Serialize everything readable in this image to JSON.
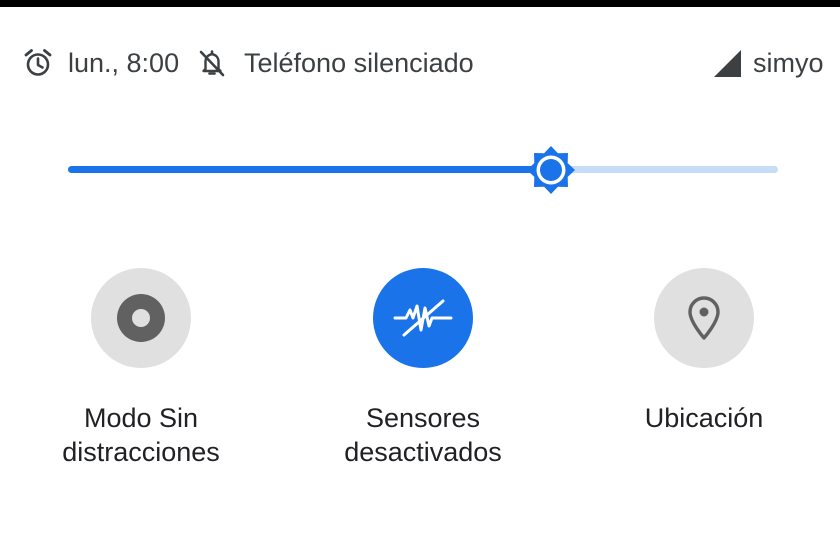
{
  "status_bar": {
    "alarm_icon": "alarm-clock-icon",
    "alarm_time": "lun., 8:00",
    "mute_icon": "bell-off-icon",
    "ringer_status": "Teléfono silenciado",
    "signal_icon": "signal-icon",
    "carrier": "simyo"
  },
  "brightness": {
    "icon": "brightness-icon",
    "level": 0.68,
    "accent_color": "#1a73e8",
    "track_color": "#c6dcf7"
  },
  "tiles": [
    {
      "label_line1": "Modo Sin",
      "label_line2": "distracciones",
      "icon": "focus-mode-icon",
      "active": false,
      "color": "#e0e0e0"
    },
    {
      "label_line1": "Sensores",
      "label_line2": "desactivados",
      "icon": "sensors-off-icon",
      "active": true,
      "color": "#1a73e8"
    },
    {
      "label_line1": "Ubicación",
      "label_line2": "",
      "icon": "location-pin-icon",
      "active": false,
      "color": "#e0e0e0"
    }
  ]
}
